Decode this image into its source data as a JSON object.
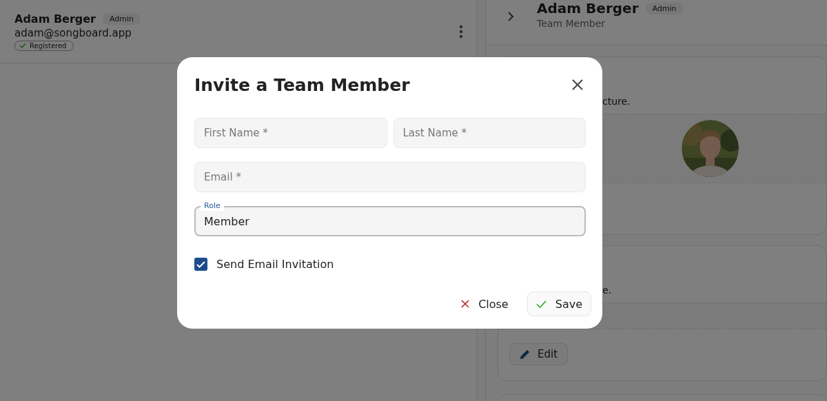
{
  "list_item": {
    "name": "Adam Berger",
    "role_badge": "Admin",
    "email": "adam@songboard.app",
    "status_chip": "Registered"
  },
  "detail": {
    "name": "Adam Berger",
    "role_badge": "Admin",
    "subtitle": "Team Member",
    "profile_card": {
      "text_fragment": "cture."
    },
    "second_card": {
      "text_fragment": "e.",
      "button": "Edit"
    }
  },
  "dialog": {
    "title": "Invite a Team Member",
    "fields": [
      {
        "placeholder": "First Name *"
      },
      {
        "placeholder": "Last Name *"
      },
      {
        "placeholder": "Email *"
      }
    ],
    "role": {
      "label": "Role",
      "value": "Member"
    },
    "checkbox": {
      "label": "Send Email Invitation",
      "checked": true
    },
    "buttons": [
      {
        "label": "Close",
        "kind": "cancel"
      },
      {
        "label": "Save",
        "kind": "confirm"
      }
    ]
  }
}
